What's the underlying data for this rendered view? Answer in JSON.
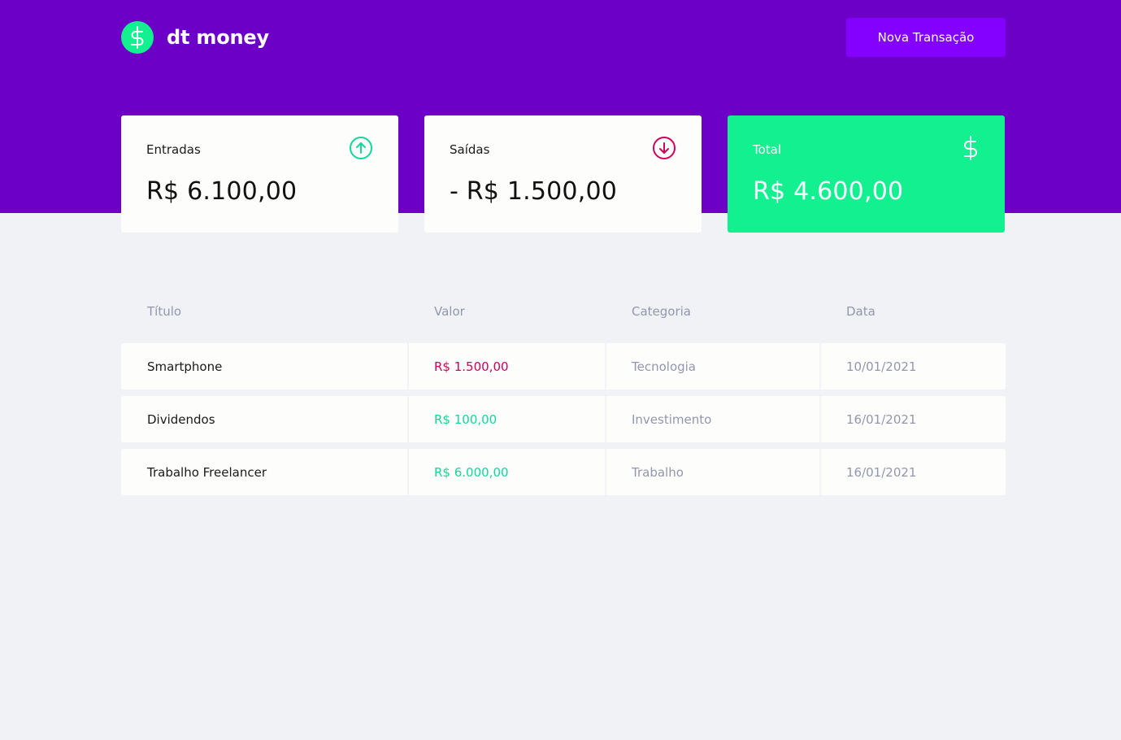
{
  "header": {
    "brand": "dt money",
    "new_transaction_label": "Nova Transação"
  },
  "summary": [
    {
      "label": "Entradas",
      "value": "R$ 6.100,00",
      "icon": "arrow-up-circle-icon"
    },
    {
      "label": "Saídas",
      "value": "- R$ 1.500,00",
      "icon": "arrow-down-circle-icon"
    },
    {
      "label": "Total",
      "value": "R$ 4.600,00",
      "icon": "dollar-icon"
    }
  ],
  "table": {
    "columns": [
      "Título",
      "Valor",
      "Categoria",
      "Data"
    ],
    "rows": [
      {
        "title": "Smartphone",
        "amount": "R$ 1.500,00",
        "type": "withdraw",
        "category": "Tecnologia",
        "date": "10/01/2021"
      },
      {
        "title": "Dividendos",
        "amount": "R$ 100,00",
        "type": "deposit",
        "category": "Investimento",
        "date": "16/01/2021"
      },
      {
        "title": "Trabalho Freelancer",
        "amount": "R$ 6.000,00",
        "type": "deposit",
        "category": "Trabalho",
        "date": "16/01/2021"
      }
    ]
  },
  "colors": {
    "header_bg": "#6c00c7",
    "button_bg": "#8400ff",
    "green": "#12f08f",
    "deposit": "#12d89a",
    "withdraw": "#d1005a",
    "muted": "#9297ad",
    "page_bg": "#f0f2f5"
  }
}
